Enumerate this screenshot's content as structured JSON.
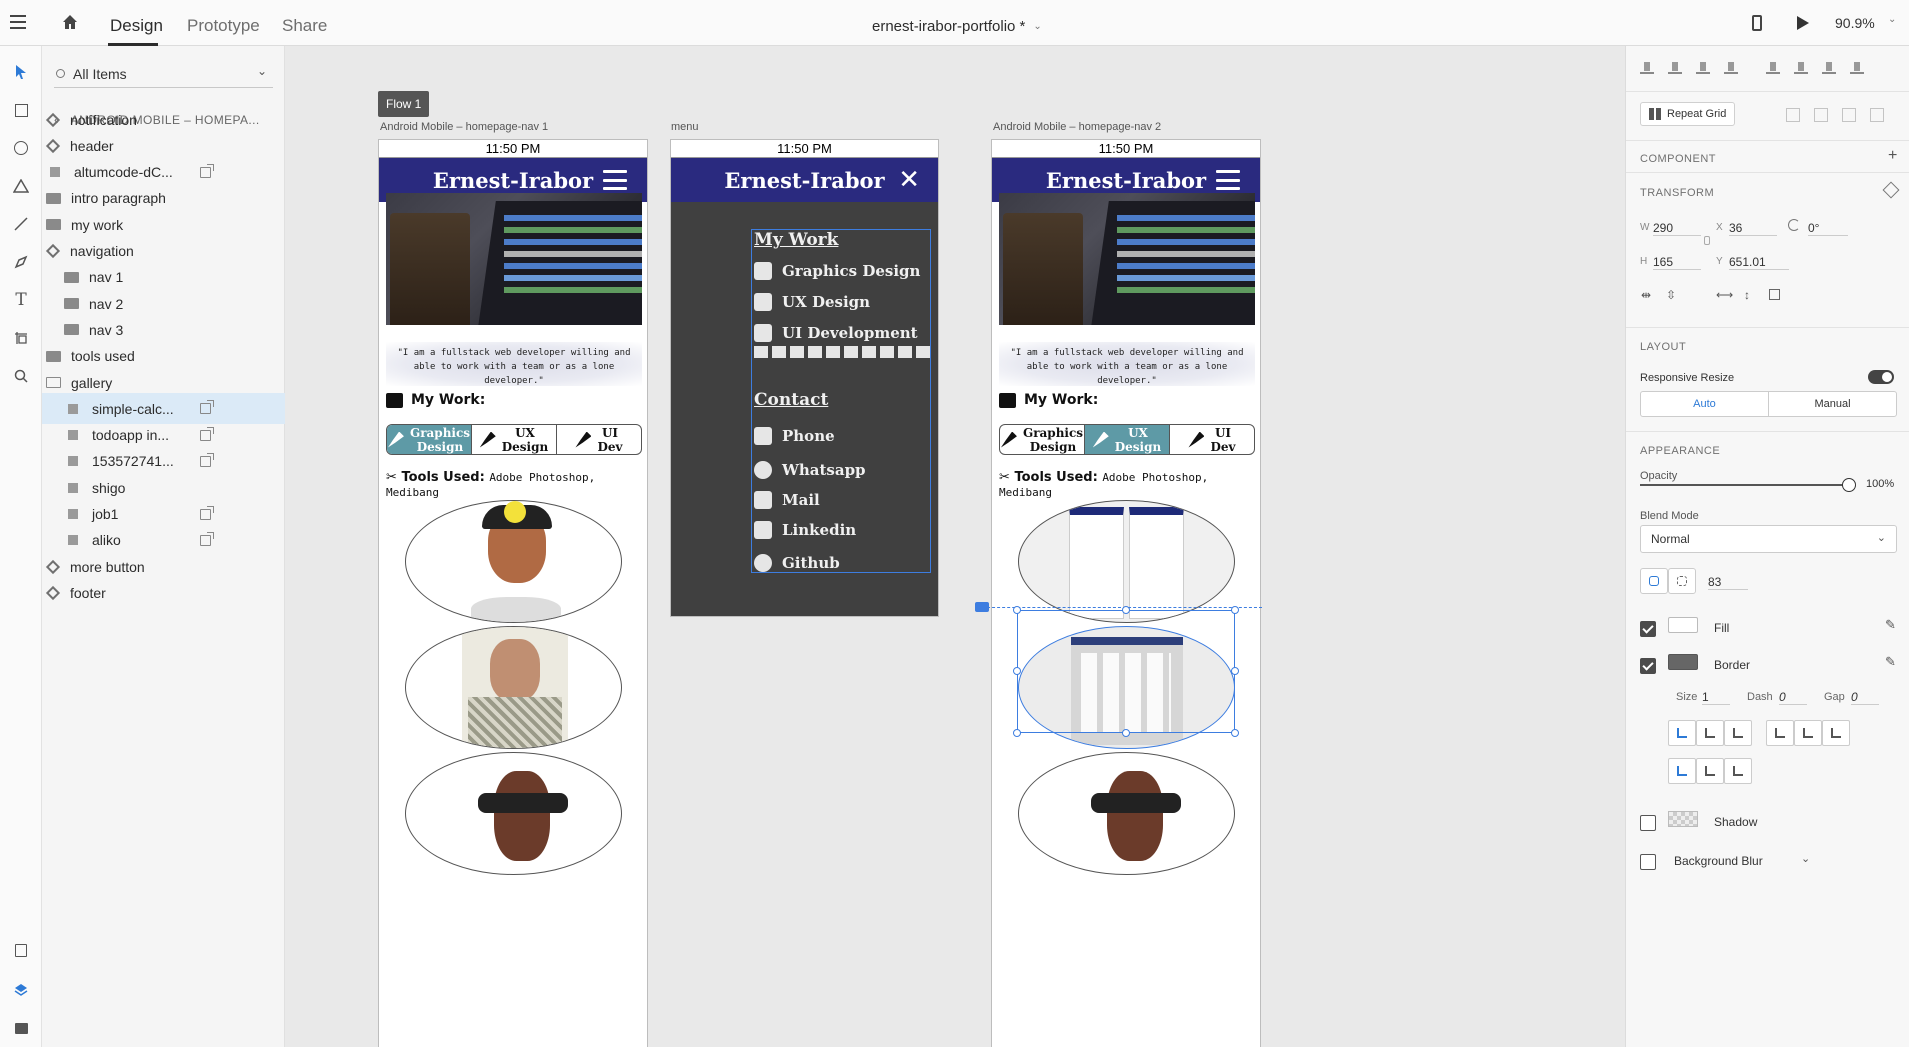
{
  "topbar": {
    "tabs": [
      "Design",
      "Prototype",
      "Share"
    ],
    "doc_title": "ernest-irabor-portfolio *",
    "zoom": "90.9%"
  },
  "layers": {
    "filter": "All Items",
    "breadcrumb": "ANDROID MOBILE – HOMEPA...",
    "items": [
      {
        "label": "notification",
        "type": "symbol",
        "indent": 0
      },
      {
        "label": "header",
        "type": "symbol",
        "indent": 0
      },
      {
        "label": "altumcode-dC...",
        "type": "image",
        "indent": 0
      },
      {
        "label": "intro paragraph",
        "type": "folder",
        "indent": 0
      },
      {
        "label": "my work",
        "type": "folder",
        "indent": 0
      },
      {
        "label": "navigation",
        "type": "symbol",
        "indent": 0
      },
      {
        "label": "nav 1",
        "type": "folder",
        "indent": 1
      },
      {
        "label": "nav 2",
        "type": "folder",
        "indent": 1
      },
      {
        "label": "nav 3",
        "type": "folder",
        "indent": 1
      },
      {
        "label": "tools used",
        "type": "folder",
        "indent": 0
      },
      {
        "label": "gallery",
        "type": "folder-open",
        "indent": 0
      },
      {
        "label": "simple-calc...",
        "type": "image",
        "indent": 1
      },
      {
        "label": "todoapp in...",
        "type": "image",
        "indent": 1
      },
      {
        "label": "153572741...",
        "type": "image",
        "indent": 1
      },
      {
        "label": "shigo",
        "type": "image",
        "indent": 1
      },
      {
        "label": "job1",
        "type": "image",
        "indent": 1
      },
      {
        "label": "aliko",
        "type": "image",
        "indent": 1
      },
      {
        "label": "more button",
        "type": "symbol",
        "indent": 0
      },
      {
        "label": "footer",
        "type": "symbol",
        "indent": 0
      }
    ]
  },
  "canvas": {
    "flow_label": "Flow 1",
    "artboards": {
      "a1": "Android Mobile – homepage-nav 1",
      "a2": "menu",
      "a3": "Android Mobile – homepage-nav 2"
    },
    "phone": {
      "time": "11:50 PM",
      "brand": "Ernest-Irabor",
      "quote_line1": "\"I am a fullstack web developer willing and",
      "quote_line2": "able to work with a team or as a lone developer.\"",
      "my_work": "My Work:",
      "tab1": [
        "Graphics",
        "Design"
      ],
      "tab2": [
        "UX",
        "Design"
      ],
      "tab3": [
        "UI",
        "Dev"
      ],
      "tools_label": "Tools Used:",
      "tools_value": "Adobe Photoshop, Medibang"
    },
    "menu": {
      "my_work": "My Work",
      "graphics": "Graphics Design",
      "ux": "UX Design",
      "ui": "UI Development",
      "contact": "Contact",
      "phone": "Phone",
      "whatsapp": "Whatsapp",
      "mail": "Mail",
      "linkedin": "Linkedin",
      "github": "Github"
    }
  },
  "properties": {
    "repeat_grid": "Repeat Grid",
    "component": "COMPONENT",
    "transform": "TRANSFORM",
    "w_label": "W",
    "w": "290",
    "x_label": "X",
    "x": "36",
    "rotation": "0°",
    "h_label": "H",
    "h": "165",
    "y_label": "Y",
    "y": "651.01",
    "layout": "LAYOUT",
    "responsive_resize": "Responsive Resize",
    "auto": "Auto",
    "manual": "Manual",
    "appearance": "APPEARANCE",
    "opacity": "Opacity",
    "opacity_value": "100%",
    "blend_mode": "Blend Mode",
    "blend_value": "Normal",
    "radius": "83",
    "fill": "Fill",
    "border": "Border",
    "size_label": "Size",
    "size": "1",
    "dash_label": "Dash",
    "dash": "0",
    "gap_label": "Gap",
    "gap": "0",
    "shadow": "Shadow",
    "bg_blur": "Background Blur"
  },
  "colors": {
    "navbar": "#2a2a7f",
    "accent": "#3d7de0",
    "tab_active": "#5e9aa6"
  }
}
